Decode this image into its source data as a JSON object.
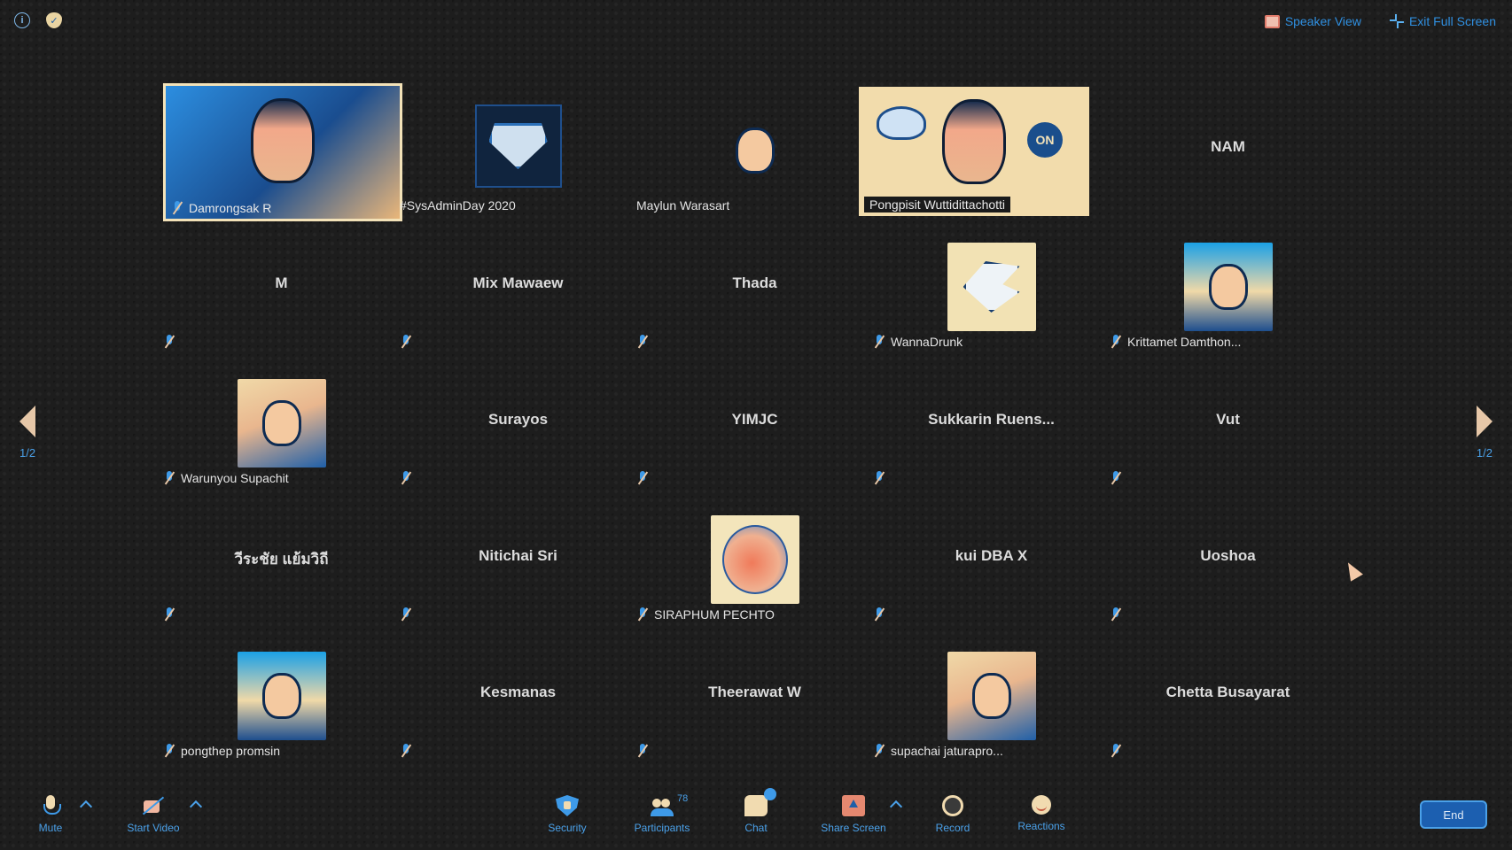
{
  "topbar": {
    "speaker_view": "Speaker View",
    "exit_full_screen": "Exit Full Screen"
  },
  "pagination": {
    "left_label": "1/2",
    "right_label": "1/2"
  },
  "tiles": [
    {
      "name": "Damrongsak R",
      "kind": "video"
    },
    {
      "name": "#SysAdminDay 2020",
      "kind": "logo"
    },
    {
      "name": "Maylun Warasart",
      "kind": "photo"
    },
    {
      "name": "Pongpisit Wuttidittachotti",
      "kind": "video"
    },
    {
      "name": "NAM",
      "kind": "text"
    },
    {
      "name": "M",
      "kind": "text"
    },
    {
      "name": "Mix Mawaew",
      "kind": "text"
    },
    {
      "name": "Thada",
      "kind": "text"
    },
    {
      "name": "WannaDrunk",
      "kind": "eagle"
    },
    {
      "name": "Krittamet Damthon...",
      "kind": "photo"
    },
    {
      "name": "Warunyou Supachit",
      "kind": "photo"
    },
    {
      "name": "Surayos",
      "kind": "text"
    },
    {
      "name": "YIMJC",
      "kind": "text"
    },
    {
      "name": "Sukkarin Ruens...",
      "kind": "text"
    },
    {
      "name": "Vut",
      "kind": "text"
    },
    {
      "name": "วีระชัย แย้มวิถี",
      "kind": "text"
    },
    {
      "name": "Nitichai Sri",
      "kind": "text"
    },
    {
      "name": "SIRAPHUM PECHTO",
      "kind": "blob"
    },
    {
      "name": "kui DBA X",
      "kind": "text"
    },
    {
      "name": "Uoshoa",
      "kind": "text"
    },
    {
      "name": "pongthep promsin",
      "kind": "photo"
    },
    {
      "name": "Kesmanas",
      "kind": "text"
    },
    {
      "name": "Theerawat W",
      "kind": "text"
    },
    {
      "name": "supachai jaturapro...",
      "kind": "photo"
    },
    {
      "name": "Chetta Busayarat",
      "kind": "text"
    }
  ],
  "toolbar": {
    "mute": "Mute",
    "start_video": "Start Video",
    "security": "Security",
    "participants": "Participants",
    "participants_count": "78",
    "chat": "Chat",
    "share_screen": "Share Screen",
    "record": "Record",
    "reactions": "Reactions",
    "end": "End"
  }
}
